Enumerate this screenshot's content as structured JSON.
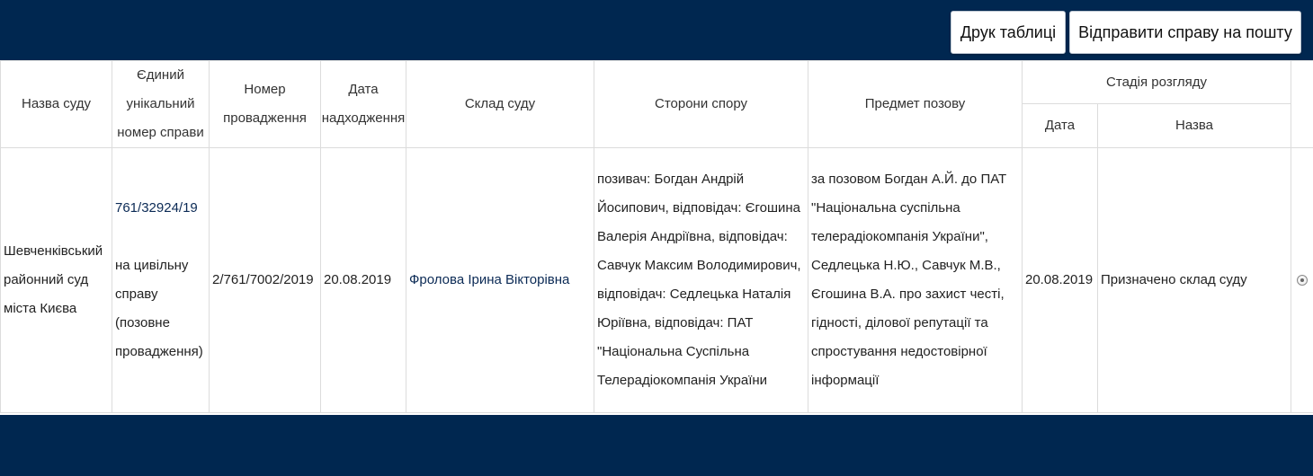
{
  "toolbar": {
    "print_label": "Друк таблиці",
    "email_label": "Відправити справу на пошту"
  },
  "table": {
    "headers": {
      "court": "Назва суду",
      "case_number_line1": "Єдиний",
      "case_number_line2": "унікальний",
      "case_number_line3": "номер справи",
      "proceeding_line1": "Номер",
      "proceeding_line2": "провадження",
      "date_line1": "Дата",
      "date_line2": "надходження",
      "judges": "Склад суду",
      "parties": "Сторони спору",
      "subject": "Предмет позову",
      "stage": "Стадія розгляду",
      "stage_date": "Дата",
      "stage_name": "Назва"
    },
    "row": {
      "court": "Шевченківський районний суд міста Києва",
      "case_number": "761/32924/19",
      "case_type": "на цивільну справу (позовне провадження)",
      "proceeding_number": "2/761/7002/2019",
      "received_date": "20.08.2019",
      "judges": "Фролова Ірина Вікторівна",
      "parties": "позивач: Богдан Андрій Йосипович, відповідач: Єгошина Валерія Андріївна, відповідач: Савчук Максим Володимирович, відповідач: Седлецька Наталія Юріївна, відповідач: ПАТ \"Національна Суспільна Телерадіокомпанія України",
      "subject": "за позовом Богдан А.Й. до ПАТ \"Національна суспільна телерадіокомпанія України\", Седлецька Н.Ю., Савчук М.В., Єгошина В.А. про захист честі, гідності, ділової репутації та спростування недостовірної інформації",
      "stage_date": "20.08.2019",
      "stage_name": "Призначено склад суду"
    }
  }
}
